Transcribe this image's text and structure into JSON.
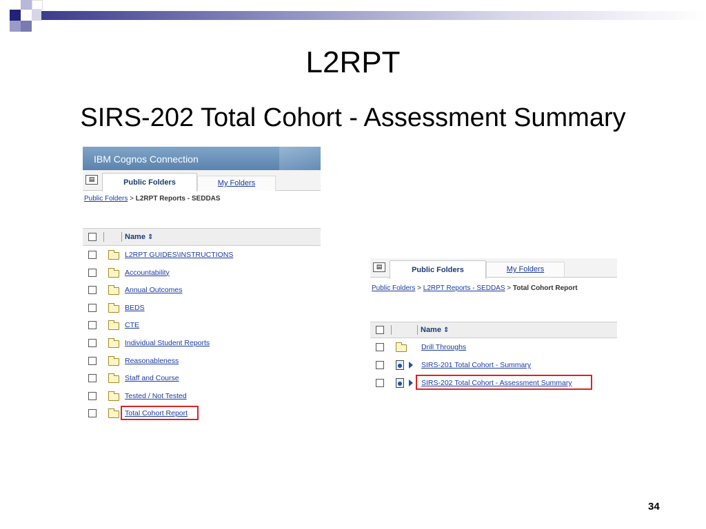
{
  "slide": {
    "title": "L2RPT",
    "subtitle": "SIRS-202 Total Cohort - Assessment Summary",
    "page_number": "34"
  },
  "shot1": {
    "app_title": "IBM Cognos Connection",
    "tabs": {
      "active": "Public Folders",
      "other": "My Folders"
    },
    "breadcrumb": {
      "link": "Public Folders",
      "sep": ">",
      "current": "L2RPT Reports - SEDDAS"
    },
    "column_header": "Name",
    "sort_icon": "sort-arrows-icon",
    "rows": [
      "L2RPT GUIDES\\INSTRUCTIONS",
      "Accountability",
      "Annual Outcomes",
      "BEDS",
      "CTE",
      "Individual Student Reports",
      "Reasonableness",
      "Staff and Course",
      "Tested / Not Tested",
      "Total Cohort Report"
    ],
    "highlighted_row": "Total Cohort Report"
  },
  "shot2": {
    "tabs": {
      "active": "Public Folders",
      "other": "My Folders"
    },
    "breadcrumb": {
      "link1": "Public Folders",
      "sep": ">",
      "link2": "L2RPT Reports - SEDDAS",
      "current": "Total Cohort Report"
    },
    "column_header": "Name",
    "rows": [
      {
        "label": "Drill Throughs",
        "kind": "folder"
      },
      {
        "label": "SIRS-201 Total Cohort - Summary",
        "kind": "report"
      },
      {
        "label": "SIRS-202 Total Cohort - Assessment Summary",
        "kind": "report"
      }
    ],
    "highlighted_row": "SIRS-202 Total Cohort - Assessment Summary"
  },
  "colors": {
    "highlight": "#e02020",
    "link": "#1a3aa0",
    "header_blue": "#5b83ad",
    "deco_dark": "#3c3c8c"
  }
}
